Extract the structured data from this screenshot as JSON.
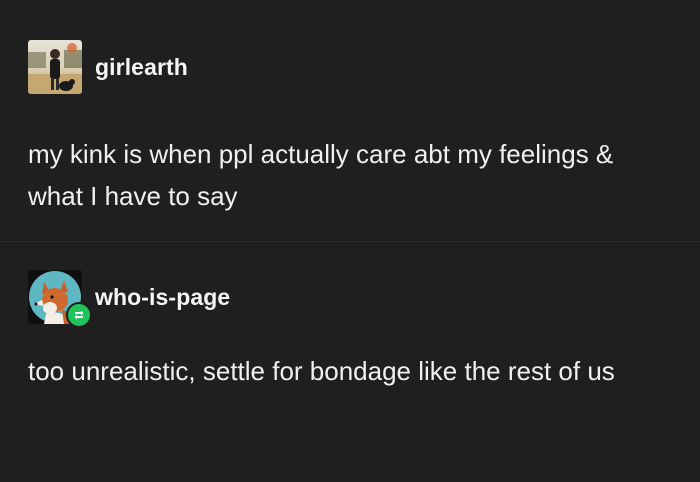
{
  "posts": [
    {
      "username": "girlearth",
      "text": "my kink is when ppl actually care abt my feelings & what I have to say",
      "avatar_icon": "person-photo-avatar"
    },
    {
      "username": "who-is-page",
      "text": "too unrealistic, settle for bondage like the rest of us",
      "avatar_icon": "fox-avatar",
      "badge_icon": "reblog-icon",
      "badge_color": "#1fc35a"
    }
  ],
  "colors": {
    "background": "#1f1f1f",
    "text": "#f0f0f0"
  }
}
